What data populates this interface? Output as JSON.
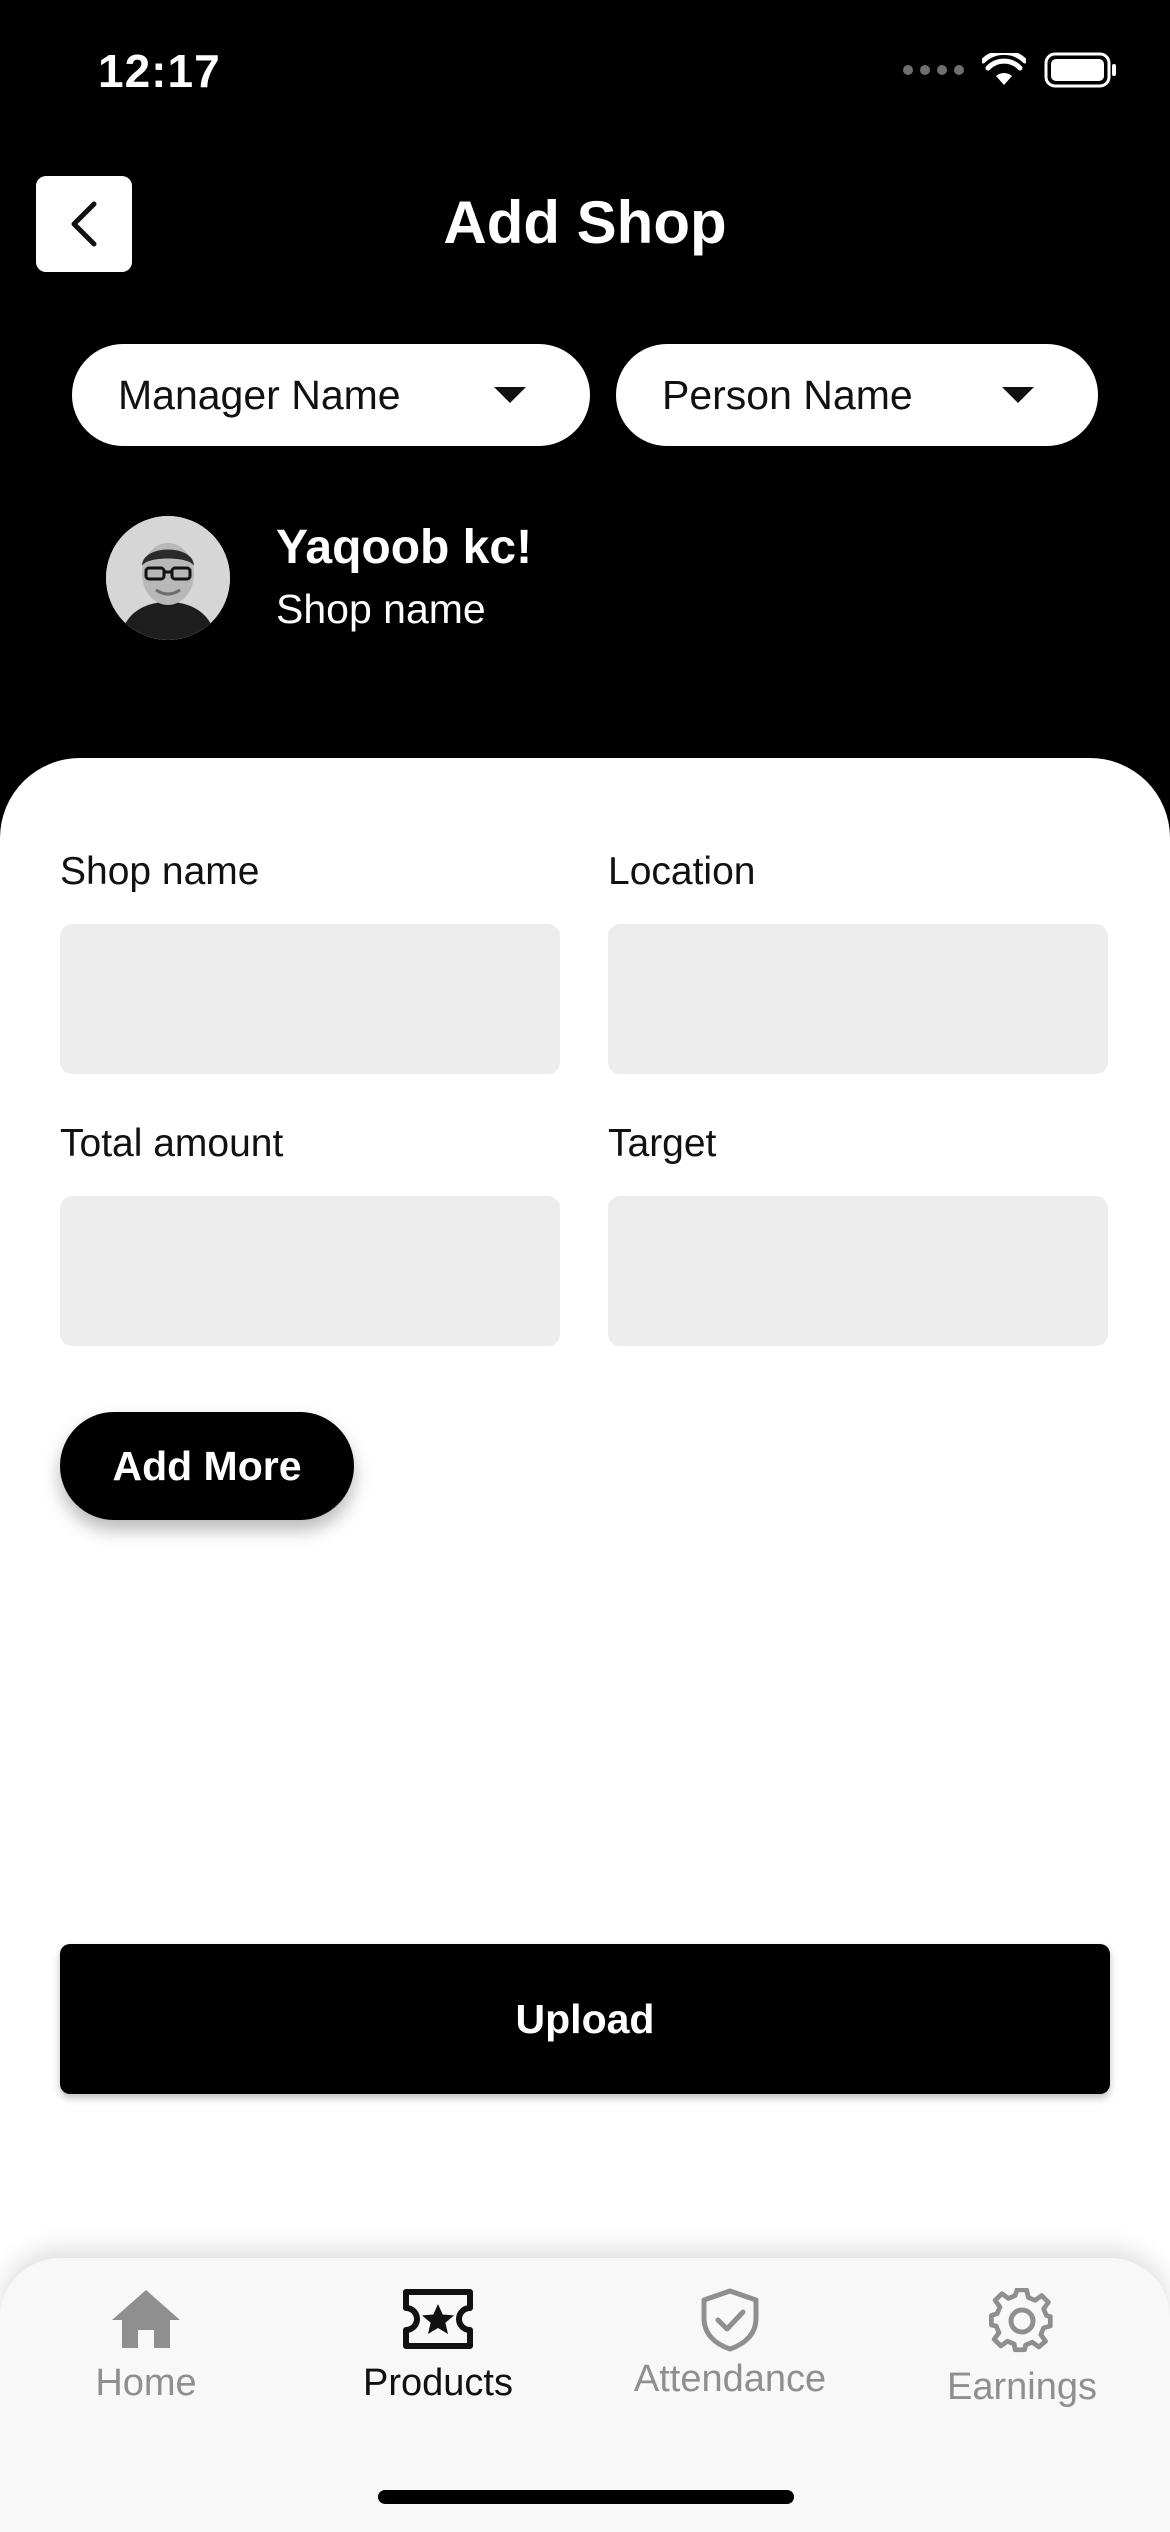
{
  "status_bar": {
    "time": "12:17"
  },
  "header": {
    "title": "Add Shop"
  },
  "filters": {
    "manager_dropdown": "Manager Name",
    "person_dropdown": "Person Name"
  },
  "user": {
    "name": "Yaqoob kc!",
    "shop": "Shop name"
  },
  "form": {
    "shop_name_label": "Shop name",
    "location_label": "Location",
    "total_amount_label": "Total amount",
    "target_label": "Target",
    "add_more_label": "Add More",
    "upload_label": "Upload"
  },
  "tab_bar": {
    "active_tab": "Products",
    "tabs": [
      {
        "label": "Home",
        "icon": "home-icon"
      },
      {
        "label": "Products",
        "icon": "ticket-star-icon"
      },
      {
        "label": "Attendance",
        "icon": "shield-check-icon"
      },
      {
        "label": "Earnings",
        "icon": "gear-icon"
      }
    ]
  },
  "colors": {
    "background": "#000000",
    "card": "#ffffff",
    "input": "#ededed",
    "inactive_tab": "#8f8f8f"
  }
}
